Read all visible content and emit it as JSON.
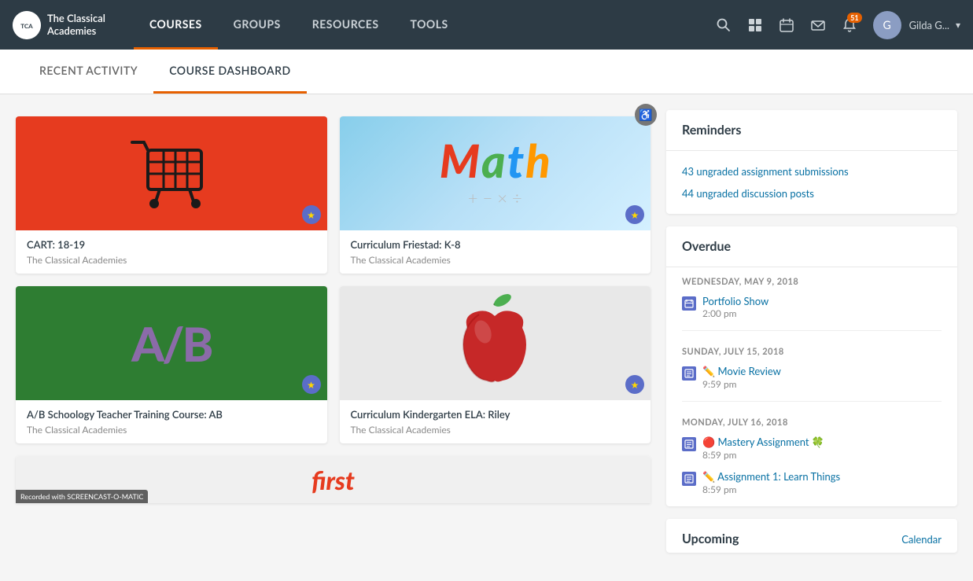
{
  "nav": {
    "logo_text": "The Classical Academies",
    "links": [
      "COURSES",
      "GROUPS",
      "RESOURCES",
      "TOOLS"
    ],
    "active_link": "COURSES",
    "search_icon": "🔍",
    "grid_icon": "⊞",
    "calendar_icon": "📅",
    "mail_icon": "✉",
    "bell_icon": "🔔",
    "notification_count": "51",
    "username": "Gilda G...",
    "chevron": "▾"
  },
  "tabs": {
    "items": [
      "RECENT ACTIVITY",
      "COURSE DASHBOARD"
    ],
    "active": "COURSE DASHBOARD"
  },
  "courses": [
    {
      "id": "cart",
      "title": "CART: 18-19",
      "org": "The Classical Academies",
      "thumb_type": "cart",
      "badge": "★"
    },
    {
      "id": "math",
      "title": "Curriculum Friestad: K-8",
      "org": "The Classical Academies",
      "thumb_type": "math",
      "badge": "★"
    },
    {
      "id": "ab",
      "title": "A/B Schoology Teacher Training Course: AB",
      "org": "The Classical Academies",
      "thumb_type": "ab",
      "badge": "★"
    },
    {
      "id": "apple",
      "title": "Curriculum Kindergarten ELA: Riley",
      "org": "The Classical Academies",
      "thumb_type": "apple",
      "badge": "★"
    }
  ],
  "reminders": {
    "title": "Reminders",
    "links": [
      "43 ungraded assignment submissions",
      "44 ungraded discussion posts"
    ]
  },
  "overdue": {
    "title": "Overdue",
    "sections": [
      {
        "date": "WEDNESDAY, MAY 9, 2018",
        "items": [
          {
            "title": "Portfolio Show",
            "time": "2:00 pm",
            "emoji": ""
          }
        ]
      },
      {
        "date": "SUNDAY, JULY 15, 2018",
        "items": [
          {
            "title": "✏️ Movie Review",
            "time": "9:59 pm",
            "emoji": ""
          }
        ]
      },
      {
        "date": "MONDAY, JULY 16, 2018",
        "items": [
          {
            "title": "🔴 Mastery Assignment 🍀",
            "time": "8:59 pm",
            "emoji": ""
          },
          {
            "title": "✏️ Assignment 1: Learn Things",
            "time": "8:59 pm",
            "emoji": ""
          }
        ]
      }
    ]
  },
  "upcoming": {
    "title": "Upcoming",
    "calendar_link": "Calendar"
  },
  "accessibility_icon": "♿",
  "screencast_text": "Recorded with SCREENCAST-O-MATIC"
}
